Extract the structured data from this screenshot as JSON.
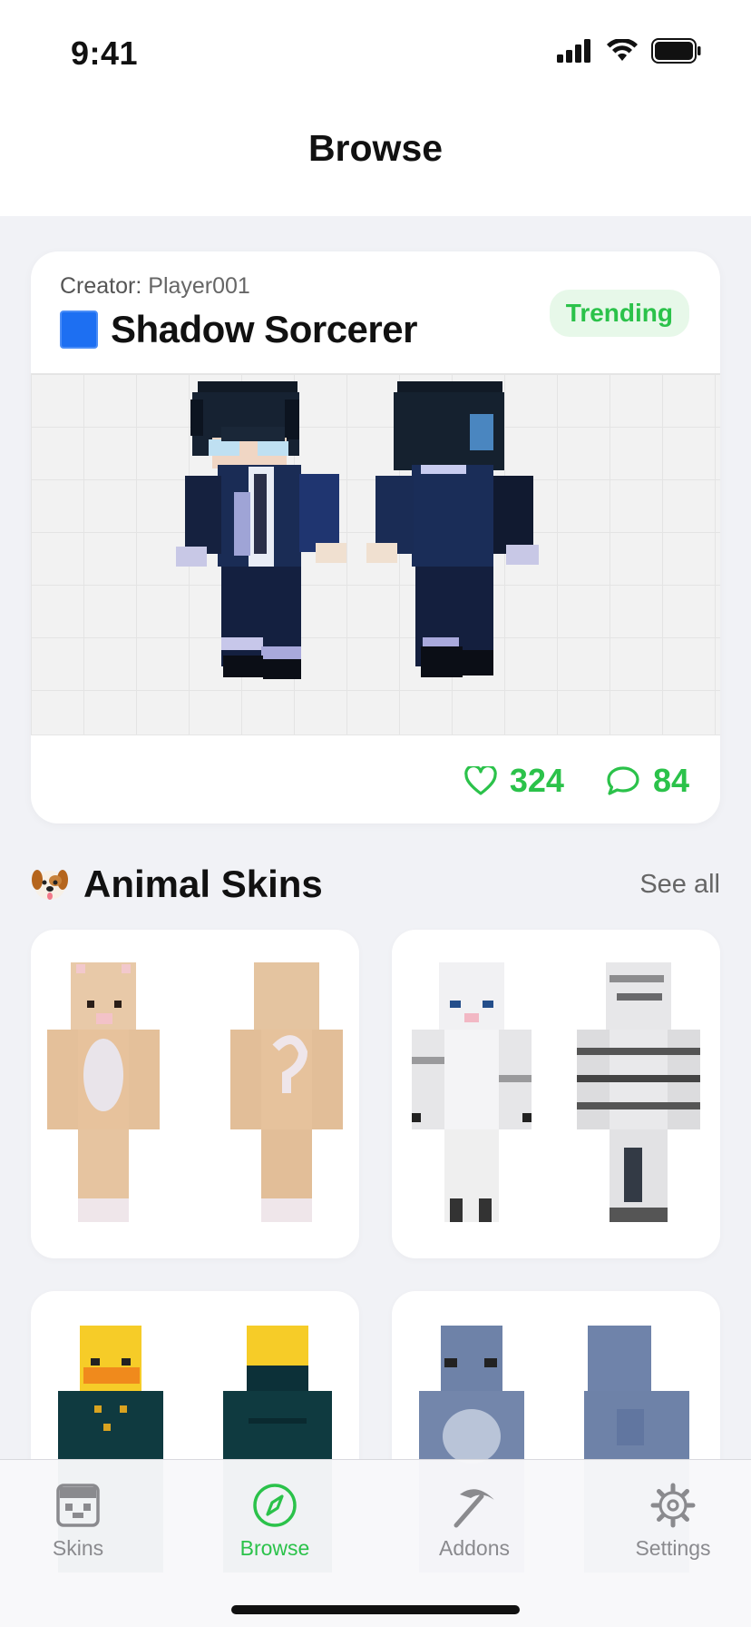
{
  "status_bar": {
    "time": "9:41"
  },
  "header": {
    "title": "Browse"
  },
  "featured": {
    "creator_label": "Creator:",
    "creator_name": "Player001",
    "title": "Shadow Sorcerer",
    "badge": "Trending",
    "likes": "324",
    "comments": "84",
    "accent_color": "#2bc24a"
  },
  "section": {
    "title": "Animal Skins",
    "see_all": "See all",
    "icon": "dog-face-icon"
  },
  "grid_items": [
    {
      "name": "cat-skin"
    },
    {
      "name": "white-tiger-skin"
    },
    {
      "name": "duck-skin"
    },
    {
      "name": "shark-skin"
    }
  ],
  "tabs": [
    {
      "label": "Skins",
      "icon": "skin-head-icon",
      "active": false
    },
    {
      "label": "Browse",
      "icon": "compass-icon",
      "active": true
    },
    {
      "label": "Addons",
      "icon": "pickaxe-icon",
      "active": false
    },
    {
      "label": "Settings",
      "icon": "gear-icon",
      "active": false
    }
  ]
}
